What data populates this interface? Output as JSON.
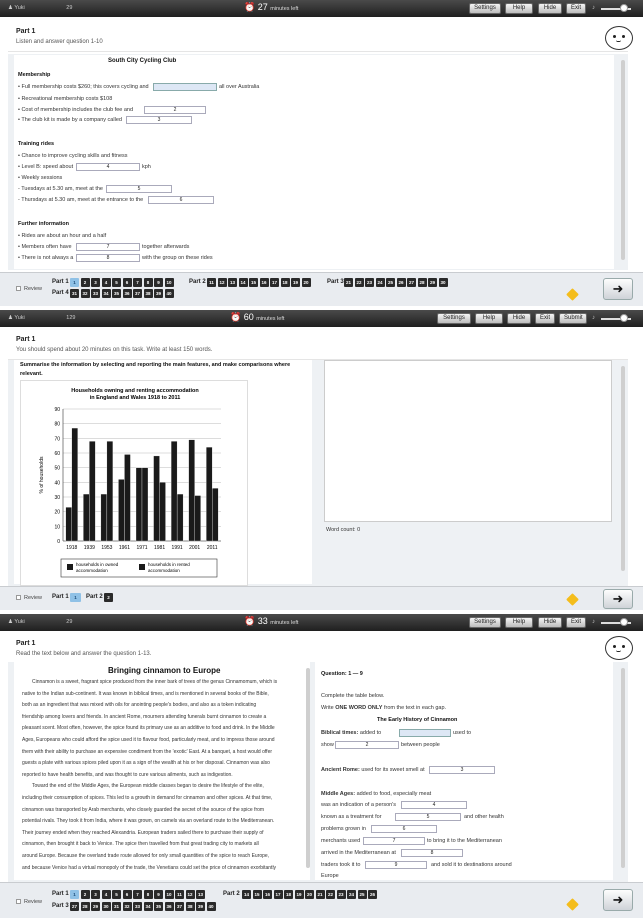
{
  "common": {
    "user": "Yuki",
    "timer_unit": "minutes left"
  },
  "p1": {
    "top": {
      "user_id": "29",
      "timer_value": "27",
      "settings": "Settings",
      "help": "Help",
      "hide": "Hide",
      "exit": "Exit"
    },
    "part_title": "Part 1",
    "instructions": "Listen and answer question 1-10",
    "form_title": "South City Cycling Club",
    "membership_heading": "Membership",
    "m1_a": "• Full membership costs $260; this covers cycling and",
    "m1_b": "all over Australia",
    "m2": "• Recreational membership costs $108",
    "m3": "• Cost of membership includes the club fee and",
    "m3_v": "2",
    "m4": "• The club kit is made by a company called",
    "m4_v": "3",
    "rides_heading": "Training rides",
    "r1": "• Chance to improve cycling skills and fitness",
    "r2_a": "• Level B: speed about",
    "r2_v": "4",
    "r2_b": "kph",
    "r3": "• Weekly sessions",
    "r4": "- Tuesdays at 5.30 am, meet at the",
    "r4_v": "5",
    "r5": "- Thursdays at 5.30 am, meet at the entrance to the",
    "r5_v": "6",
    "further_heading": "Further information",
    "f1": "• Rides are about an hour and a half",
    "f2_a": "• Members often have",
    "f2_v": "7",
    "f2_b": "together afterwards",
    "f3_a": "• There is not always a",
    "f3_v": "8",
    "f3_b": "with the group on these rides",
    "review": "Review",
    "part1_label": "Part 1",
    "part2_label": "Part 2",
    "part3_label": "Part 3",
    "part4_label": "Part 4",
    "part1_q": [
      "1",
      "2",
      "3",
      "4",
      "5",
      "6",
      "7",
      "8",
      "9",
      "10"
    ],
    "part2_q": [
      "11",
      "12",
      "13",
      "14",
      "15",
      "16",
      "17",
      "18",
      "19",
      "20"
    ],
    "part3_q": [
      "21",
      "22",
      "23",
      "24",
      "25",
      "26",
      "27",
      "28",
      "29",
      "30"
    ],
    "part4_q": [
      "31",
      "32",
      "33",
      "34",
      "35",
      "36",
      "37",
      "38",
      "39",
      "40"
    ]
  },
  "p2": {
    "top": {
      "user_id": "129",
      "timer_value": "60",
      "timer_unit": "minutes left",
      "settings": "Settings",
      "help": "Help",
      "hide": "Hide",
      "exit": "Exit",
      "submit": "Submit"
    },
    "part_title": "Part 1",
    "instructions": "You should spend about 20 minutes on this task. Write at least 150 words.",
    "prompt_1": "Summarise the information by selecting and reporting the main features, and make comparisons where",
    "prompt_2": "relevant.",
    "word_count": "Word count: 0",
    "review": "Review",
    "part1_label": "Part 1",
    "part1_q": "1",
    "part2_label": "Part 2",
    "part2_q": "2"
  },
  "chart_data": {
    "type": "bar",
    "title": "Households owning and renting accommodation in England and Wales 1918 to 2011",
    "title_line1": "Households owning and renting accommodation",
    "title_line2": "in England and Wales 1918 to 2011",
    "ylabel": "% of households",
    "xlabel": "",
    "ylim": [
      0,
      90
    ],
    "yticks": [
      "0",
      "10",
      "20",
      "30",
      "40",
      "50",
      "60",
      "70",
      "80",
      "90"
    ],
    "categories": [
      "1918",
      "1939",
      "1953",
      "1961",
      "1971",
      "1981",
      "1991",
      "2001",
      "2011"
    ],
    "series": [
      {
        "name": "households in owned accommodation",
        "color": "#1a1a1a",
        "values": [
          23,
          32,
          32,
          42,
          50,
          58,
          68,
          69,
          64
        ]
      },
      {
        "name": "households in rented accommodation",
        "color": "#1a1a1a",
        "values": [
          77,
          68,
          68,
          59,
          50,
          40,
          32,
          31,
          36
        ]
      }
    ],
    "legend_placement": "bottom",
    "legend_owned": "households in owned accommodation",
    "legend_rented": "households in rented accommodation",
    "grid": true
  },
  "p3": {
    "top": {
      "user_id": "29",
      "timer_value": "33",
      "settings": "Settings",
      "help": "Help",
      "hide": "Hide",
      "exit": "Exit"
    },
    "part_title": "Part 1",
    "instructions": "Read the text below and answer the question 1-13.",
    "passage_title": "Bringing cinnamon to Europe",
    "lines": [
      "Cinnamon is a sweet, fragrant spice produced from the inner bark of trees of the genus Cinnamomum, which is",
      "native to the Indian sub-continent. It was known in biblical times, and is mentioned in several books of the Bible,",
      "both as an ingredient that was mixed with oils for anointing people's bodies, and also as a token indicating",
      "friendship among lovers and friends. In ancient Rome, mourners attending funerals burnt cinnamon to create a",
      "pleasant scent. Most often, however, the spice found its primary use as an additive to food and drink. In the Middle",
      "Ages, Europeans who could afford the spice used it to flavour food, particularly meat, and to impress those around",
      "them with their ability to purchase an expensive condiment from the 'exotic' East. At a banquet, a host would offer",
      "guests a plate with various spices piled upon it as a sign of the wealth at his or her disposal. Cinnamon was also",
      "reported to have health benefits, and was thought to cure various ailments, such as indigestion.",
      "Toward the end of the Middle Ages, the European middle classes began to desire the lifestyle of the elite,",
      "including their consumption of spices. This led to a growth in demand for cinnamon and other spices. At that time,",
      "cinnamon was transported by Arab merchants, who closely guarded the secret of the source of the spice from",
      "potential rivals. They took it from India, where it was grown, on camels via an overland route to the Mediterranean.",
      "Their journey ended when they reached Alexandria. European traders sailed there to purchase their supply of",
      "cinnamon, then brought it back to Venice. The spice then travelled from that great trading city to markets all",
      "around Europe. Because the overland trade route allowed for only small quantities of the spice to reach Europe,",
      "and because Venice had a virtual monopoly of the trade, the Venetians could set the price of cinnamon exorbitantly"
    ],
    "q_range": "Question: 1 — 9",
    "q_inst": "Complete the table below.",
    "q_words_a": "Write",
    "q_words_b": "ONE WORD ONLY",
    "q_words_c": "from the text in each gap.",
    "table_title": "The Early History of Cinnamon",
    "biblical_label": "Biblical times:",
    "biblical_a": "added to",
    "biblical_b": "used to",
    "b2_a": "show",
    "b2_v": "2",
    "b2_b": "between people",
    "rome_label": "Ancient Rome:",
    "rome_a": "used for its sweet smell at",
    "rome_v": "3",
    "middle_label": "Middle Ages:",
    "middle_a": "added to food, especially meat",
    "ma2_a": "was an indication of a person's",
    "ma2_v": "4",
    "ma3_a": "known as a treatment for",
    "ma3_v": "5",
    "ma3_b": "and other health",
    "ma4_a": "problems grown in",
    "ma4_v": "6",
    "ma5_a": "merchants used",
    "ma5_v": "7",
    "ma5_b": "to bring it to the Mediterranean",
    "ma6_a": "arrived in the Mediterranean at",
    "ma6_v": "8",
    "ma7_a": "traders took it to",
    "ma7_v": "9",
    "ma7_b": "and sold it to destinations around",
    "ma8": "Europe",
    "review": "Review",
    "part1_label": "Part 1",
    "part2_label": "Part 2",
    "part3_label": "Part 3",
    "part1_q": [
      "1",
      "2",
      "3",
      "4",
      "5",
      "6",
      "7",
      "8",
      "9",
      "10",
      "11",
      "12",
      "13"
    ],
    "part2_q": [
      "14",
      "15",
      "16",
      "17",
      "18",
      "19",
      "20",
      "21",
      "22",
      "23",
      "24",
      "25",
      "26"
    ],
    "part3_q": [
      "27",
      "28",
      "29",
      "30",
      "31",
      "32",
      "33",
      "34",
      "35",
      "36",
      "37",
      "38",
      "39",
      "40"
    ]
  }
}
